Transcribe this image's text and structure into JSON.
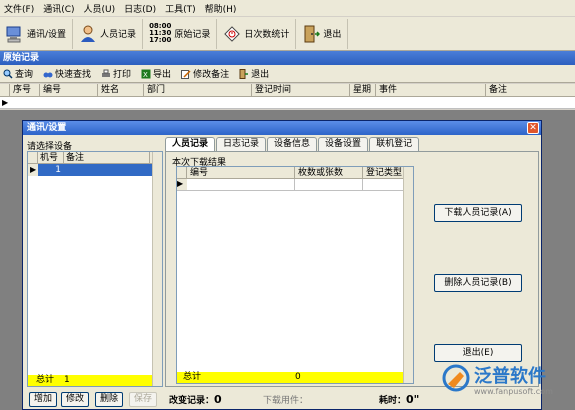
{
  "menu": [
    "文件(F)",
    "通讯(C)",
    "人员(U)",
    "日志(D)",
    "工具(T)",
    "帮助(H)"
  ],
  "toolbar": {
    "comm": "通讯/设置",
    "personnel": "人员记录",
    "clock_times": [
      "08:00",
      "11:30",
      "17:00"
    ],
    "raw_records": "原始记录",
    "daily_stats": "日次数统计",
    "exit": "退出"
  },
  "section_title": "原始记录",
  "subtoolbar": [
    "查询",
    "快速查找",
    "打印",
    "导出",
    "修改备注",
    "退出"
  ],
  "grid_columns": [
    "序号",
    "编号",
    "姓名",
    "部门",
    "登记时间",
    "星期",
    "事件",
    "备注"
  ],
  "dialog": {
    "title": "通讯/设置",
    "close": "✕",
    "select_device": "请选择设备",
    "device_columns": [
      "机号",
      "备注"
    ],
    "device_rows": [
      {
        "id": "1",
        "note": ""
      }
    ],
    "device_total_label": "总计",
    "device_total_value": "1",
    "left_buttons": [
      "增加",
      "修改",
      "删除",
      "保存"
    ],
    "tabs": [
      "人员记录",
      "日志记录",
      "设备信息",
      "设备设置",
      "联机登记"
    ],
    "result_label": "本次下载结果",
    "result_columns": [
      "编号",
      "枚数或张数",
      "登记类型"
    ],
    "result_total_label": "总计",
    "result_total_value": "0",
    "download_btn": "下载人员记录(A)",
    "delete_btn": "删除人员记录(B)",
    "exit_btn": "退出(E)",
    "status_changed_label": "改变记录：",
    "status_changed_value": "0",
    "status_downloading": "下载用件：",
    "status_time_label": "耗时：",
    "status_time_value": "0\""
  },
  "logo": {
    "name": "泛普软件",
    "url": "www.fanpusoft.com"
  }
}
